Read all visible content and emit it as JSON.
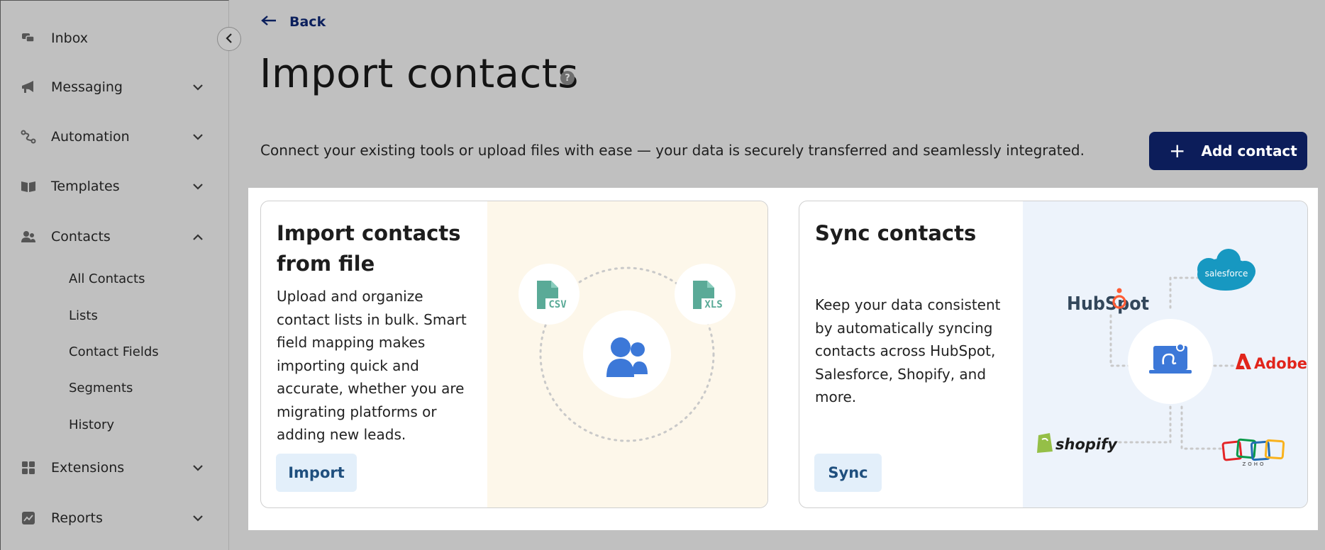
{
  "sidebar": {
    "items": [
      {
        "label": "Inbox",
        "icon": "chat-bubbles-icon"
      },
      {
        "label": "Messaging",
        "icon": "megaphone-icon"
      },
      {
        "label": "Automation",
        "icon": "flow-icon"
      },
      {
        "label": "Templates",
        "icon": "book-icon"
      },
      {
        "label": "Contacts",
        "icon": "people-icon"
      },
      {
        "label": "Extensions",
        "icon": "grid-icon"
      },
      {
        "label": "Reports",
        "icon": "chart-icon"
      }
    ],
    "contacts_sub": [
      "All Contacts",
      "Lists",
      "Contact Fields",
      "Segments",
      "History"
    ]
  },
  "header": {
    "back_label": "Back",
    "title": "Import contacts",
    "help": "?",
    "subtitle": "Connect your existing tools or upload files with ease — your data is securely transferred and seamlessly integrated.",
    "add_contact_plus": "+",
    "add_contact_label": "Add contact"
  },
  "cards": {
    "file": {
      "title": "Import contacts from file",
      "description": "Upload and organize contact lists in bulk. Smart field mapping makes importing quick and accurate, whether you are migrating platforms or adding new leads.",
      "button": "Import",
      "badges": [
        "CSV",
        "XLS"
      ]
    },
    "sync": {
      "title": "Sync contacts",
      "description": "Keep your data consistent by automatically syncing contacts across HubSpot, Salesforce, Shopify, and more.",
      "button": "Sync",
      "logos": {
        "hubspot": "HubSpot",
        "salesforce": "salesforce",
        "adobe": "Adobe",
        "shopify": "shopify",
        "zoho": "ZOHO"
      }
    }
  },
  "colors": {
    "navy": "#0c1d5a",
    "teal": "#5aaa97",
    "blue": "#3c78d8",
    "hubspot_orange": "#ff5c35",
    "salesforce_blue": "#1798c1",
    "adobe_red": "#e1251b",
    "shopify_green": "#95bf47"
  }
}
